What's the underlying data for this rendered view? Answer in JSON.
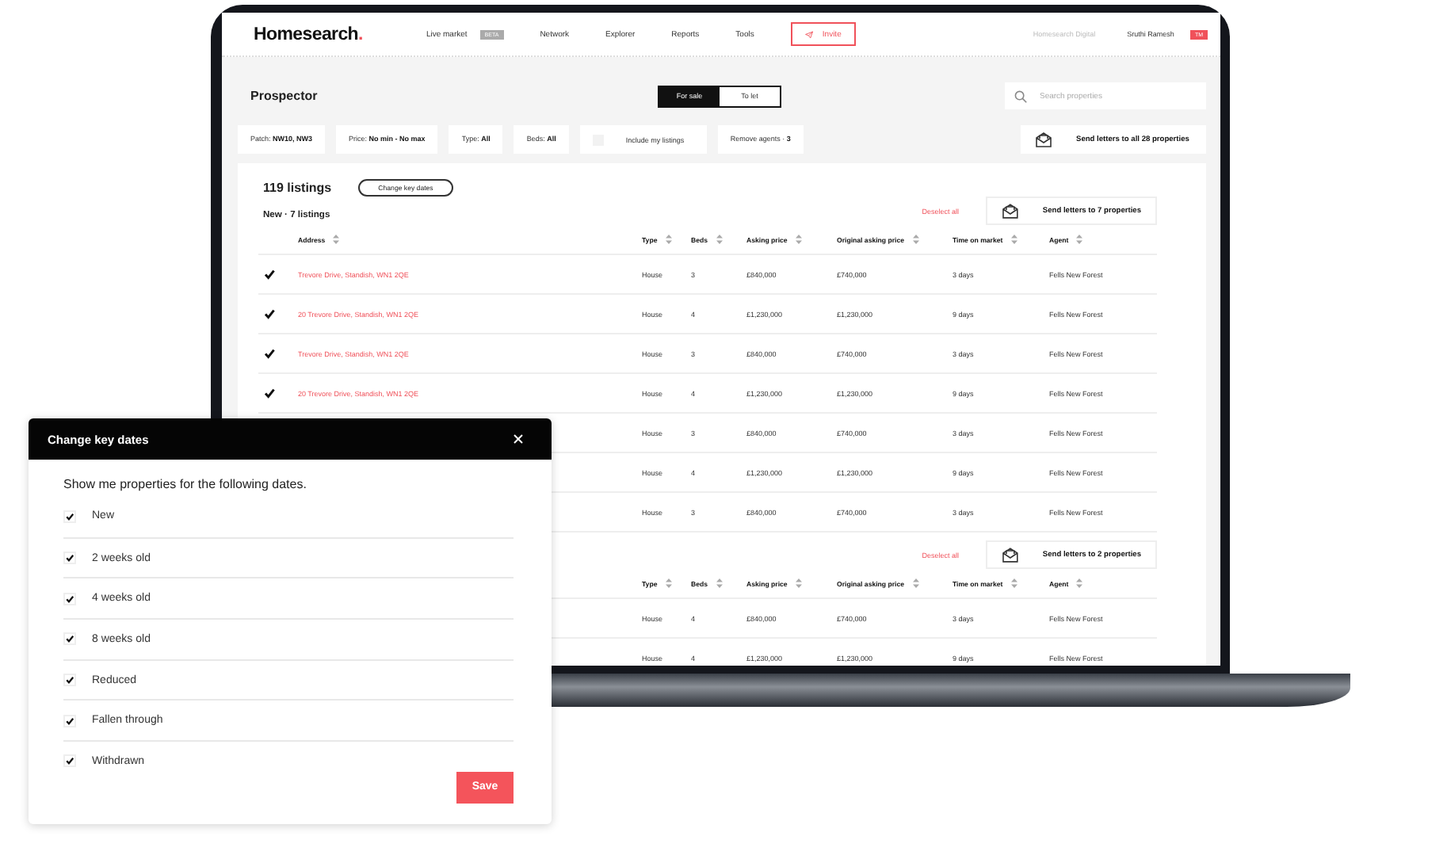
{
  "nav": {
    "logo": "Homesearch",
    "logo_dot": ".",
    "links": [
      {
        "label": "Live market",
        "badge": "BETA"
      },
      {
        "label": "Network"
      },
      {
        "label": "Explorer"
      },
      {
        "label": "Reports"
      },
      {
        "label": "Tools"
      }
    ],
    "invite": "Invite",
    "org": "Homesearch Digital",
    "user": "Sruthi Ramesh",
    "user_badge": "TM"
  },
  "page": {
    "title": "Prospector",
    "toggle": [
      {
        "label": "For sale",
        "selected": true
      },
      {
        "label": "To let",
        "selected": false
      }
    ],
    "search": {
      "placeholder": "Search properties"
    }
  },
  "filters": [
    {
      "kind": "chip",
      "label": "Patch: **NW10, NW3**"
    },
    {
      "kind": "chip",
      "label": "Price: **No min - No max**"
    },
    {
      "kind": "chip",
      "label": "Type: **All**"
    },
    {
      "kind": "chip",
      "label": "Beds: **All**"
    },
    {
      "kind": "checkbox",
      "label": "Include my listings",
      "checked": false
    },
    {
      "kind": "chip",
      "label": "Remove agents · **3**"
    }
  ],
  "send_all": "Send letters to all 28 properties",
  "listings": {
    "count": "119 listings",
    "change_button": "Change key dates",
    "groups": [
      {
        "title": "New · 7 listings",
        "deselect": "Deselect all",
        "send": "Send letters to 7 properties",
        "columns": {
          "address": "Address",
          "type": "Type",
          "beds": "Beds",
          "asking_price": "Asking price",
          "original_price": "Original asking price",
          "time_on_market": "Time on market",
          "agent": "Agent"
        },
        "rows": [
          {
            "checked": true,
            "address": "Trevore Drive, Standish, WN1 2QE",
            "type": "House",
            "beds": "3",
            "asking_price": "£840,000",
            "original_price": "£740,000",
            "time_on_market": "3 days",
            "agent": "Fells New Forest"
          },
          {
            "checked": true,
            "address": "20 Trevore Drive, Standish, WN1 2QE",
            "type": "House",
            "beds": "4",
            "asking_price": "£1,230,000",
            "original_price": "£1,230,000",
            "time_on_market": "9 days",
            "agent": "Fells New Forest"
          },
          {
            "checked": true,
            "address": "Trevore Drive, Standish, WN1 2QE",
            "type": "House",
            "beds": "3",
            "asking_price": "£840,000",
            "original_price": "£740,000",
            "time_on_market": "3 days",
            "agent": "Fells New Forest"
          },
          {
            "checked": true,
            "address": "20 Trevore Drive, Standish, WN1 2QE",
            "type": "House",
            "beds": "4",
            "asking_price": "£1,230,000",
            "original_price": "£1,230,000",
            "time_on_market": "9 days",
            "agent": "Fells New Forest"
          },
          {
            "type": "House",
            "beds": "3",
            "asking_price": "£840,000",
            "original_price": "£740,000",
            "time_on_market": "3 days",
            "agent": "Fells New Forest"
          },
          {
            "type": "House",
            "beds": "4",
            "asking_price": "£1,230,000",
            "original_price": "£1,230,000",
            "time_on_market": "9 days",
            "agent": "Fells New Forest"
          },
          {
            "type": "House",
            "beds": "3",
            "asking_price": "£840,000",
            "original_price": "£740,000",
            "time_on_market": "3 days",
            "agent": "Fells New Forest"
          }
        ]
      },
      {
        "deselect": "Deselect all",
        "send": "Send letters to 2 properties",
        "columns": {
          "type": "Type",
          "beds": "Beds",
          "asking_price": "Asking price",
          "original_price": "Original asking price",
          "time_on_market": "Time on market",
          "agent": "Agent"
        },
        "rows": [
          {
            "type": "House",
            "beds": "4",
            "asking_price": "£840,000",
            "original_price": "£740,000",
            "time_on_market": "3 days",
            "agent": "Fells New Forest"
          },
          {
            "type": "House",
            "beds": "4",
            "asking_price": "£1,230,000",
            "original_price": "£1,230,000",
            "time_on_market": "9 days",
            "agent": "Fells New Forest"
          }
        ]
      }
    ]
  },
  "modal": {
    "title": "Change key dates",
    "intro": "Show me properties for the following dates.",
    "options": [
      {
        "label": "New",
        "checked": true
      },
      {
        "label": "2 weeks old",
        "checked": true
      },
      {
        "label": "4 weeks old",
        "checked": true
      },
      {
        "label": "8 weeks old",
        "checked": true
      },
      {
        "label": "Reduced",
        "checked": true
      },
      {
        "label": "Fallen through",
        "checked": true
      },
      {
        "label": "Withdrawn",
        "checked": true
      }
    ],
    "save": "Save"
  }
}
